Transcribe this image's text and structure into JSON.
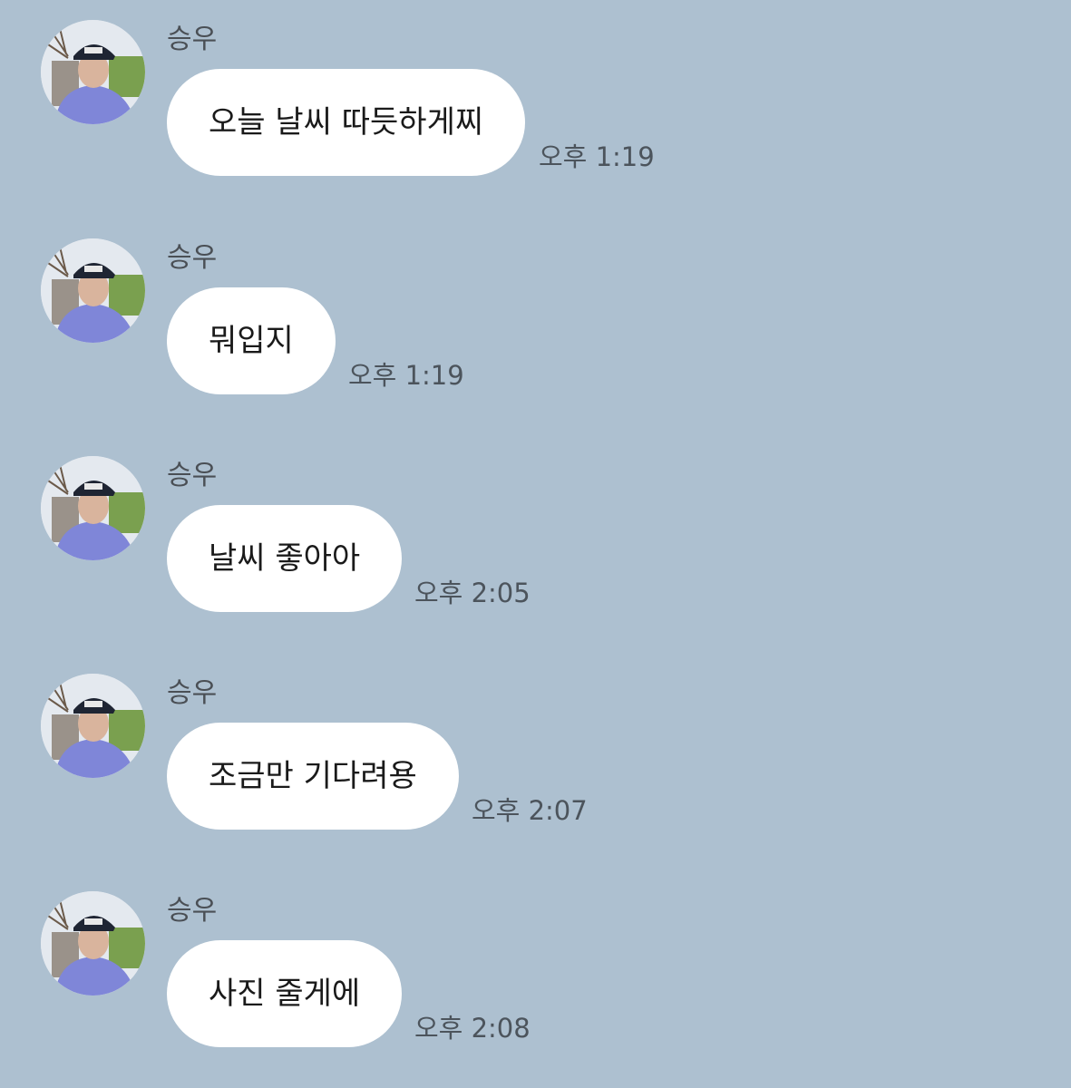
{
  "messages": [
    {
      "sender": "승우",
      "text": "오늘 날씨 따듯하게찌",
      "time": "오후 1:19"
    },
    {
      "sender": "승우",
      "text": "뭐입지",
      "time": "오후 1:19"
    },
    {
      "sender": "승우",
      "text": "날씨 좋아아",
      "time": "오후 2:05"
    },
    {
      "sender": "승우",
      "text": "조금만 기다려용",
      "time": "오후 2:07"
    },
    {
      "sender": "승우",
      "text": "사진 줄게에",
      "time": "오후 2:08"
    }
  ],
  "icons": {
    "avatar": "profile-photo"
  },
  "colors": {
    "background": "#adc0d0",
    "bubble": "#ffffff",
    "text": "#1a1a1a",
    "meta_text": "#4c545c"
  }
}
